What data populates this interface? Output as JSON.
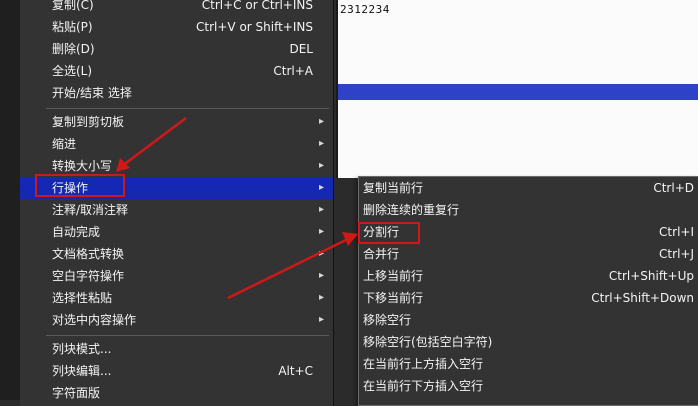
{
  "editor": {
    "text": "2312234"
  },
  "main_menu": {
    "items": [
      {
        "label": "复制(C)",
        "shortcut": "Ctrl+C or Ctrl+INS"
      },
      {
        "label": "粘贴(P)",
        "shortcut": "Ctrl+V or Shift+INS"
      },
      {
        "label": "删除(D)",
        "shortcut": "DEL"
      },
      {
        "label": "全选(L)",
        "shortcut": "Ctrl+A"
      },
      {
        "label": "开始/结束 选择",
        "shortcut": ""
      },
      {
        "label": "复制到剪切板",
        "shortcut": ""
      },
      {
        "label": "缩进",
        "shortcut": ""
      },
      {
        "label": "转换大小写",
        "shortcut": ""
      },
      {
        "label": "行操作",
        "shortcut": ""
      },
      {
        "label": "注释/取消注释",
        "shortcut": ""
      },
      {
        "label": "自动完成",
        "shortcut": ""
      },
      {
        "label": "文档格式转换",
        "shortcut": ""
      },
      {
        "label": "空白字符操作",
        "shortcut": ""
      },
      {
        "label": "选择性粘贴",
        "shortcut": ""
      },
      {
        "label": "对选中内容操作",
        "shortcut": ""
      },
      {
        "label": "列块模式...",
        "shortcut": ""
      },
      {
        "label": "列块编辑...",
        "shortcut": "Alt+C"
      },
      {
        "label": "字符面版",
        "shortcut": ""
      }
    ],
    "selected_index": 8
  },
  "sub_menu": {
    "items": [
      {
        "label": "复制当前行",
        "shortcut": "Ctrl+D"
      },
      {
        "label": "删除连续的重复行",
        "shortcut": ""
      },
      {
        "label": "分割行",
        "shortcut": "Ctrl+I"
      },
      {
        "label": "合并行",
        "shortcut": "Ctrl+J"
      },
      {
        "label": "上移当前行",
        "shortcut": "Ctrl+Shift+Up"
      },
      {
        "label": "下移当前行",
        "shortcut": "Ctrl+Shift+Down"
      },
      {
        "label": "移除空行",
        "shortcut": ""
      },
      {
        "label": "移除空行(包括空白字符)",
        "shortcut": ""
      },
      {
        "label": "在当前行上方插入空行",
        "shortcut": ""
      },
      {
        "label": "在当前行下方插入空行",
        "shortcut": ""
      }
    ]
  },
  "icons": {
    "submenu_arrow": "chevron-right-icon"
  },
  "colors": {
    "menu_bg": "#333333",
    "selected_bg": "#1428b4",
    "annotation_red": "#d01818",
    "editor_bg": "#fbfbfb",
    "editor_highlight": "#2e42c8"
  }
}
